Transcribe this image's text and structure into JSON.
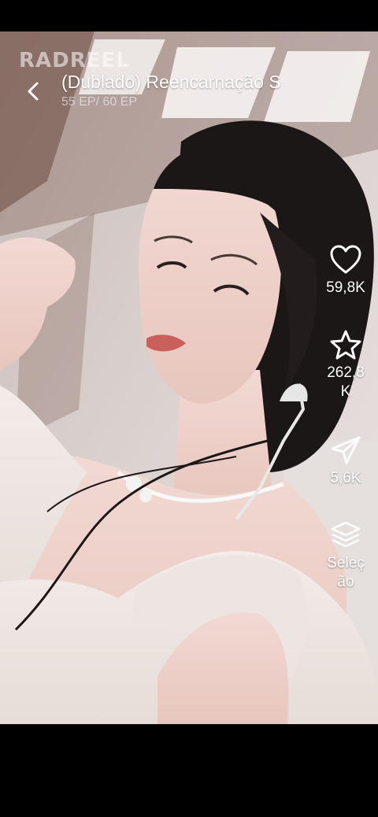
{
  "video": {
    "watermark": "RADREEL",
    "title": "(Dublado) Reencarnação S",
    "episode": "55 EP/ 60 EP"
  },
  "actions": {
    "like": {
      "icon": "heart-icon",
      "count": "59,8K"
    },
    "favorite": {
      "icon": "star-icon",
      "count_line1": "262,8",
      "count_line2": "K"
    },
    "share": {
      "icon": "send-icon",
      "count": "5,6K"
    },
    "episodes": {
      "icon": "layers-icon",
      "label_line1": "Seleç",
      "label_line2": "ão"
    }
  },
  "colors": {
    "background": "#000000",
    "text": "#ffffff"
  }
}
